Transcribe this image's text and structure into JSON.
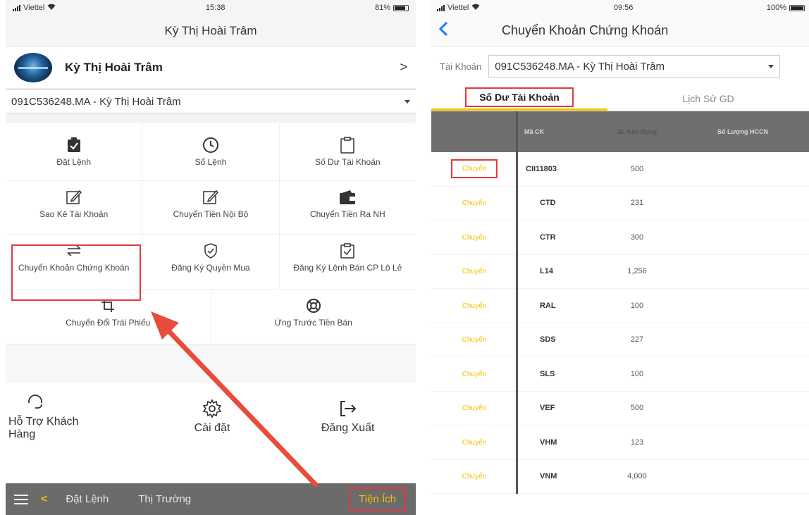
{
  "left": {
    "status": {
      "carrier": "Viettel",
      "time": "15:38",
      "battery": "81%",
      "battery_level": 0.81
    },
    "title": "Kỳ Thị Hoài Trâm",
    "profile_name": "Kỳ Thị Hoài Trâm",
    "account": "091C536248.MA - Kỳ Thị Hoài Trâm",
    "menu": {
      "row1": [
        "Đặt Lệnh",
        "Sổ Lệnh",
        "Số Dư Tài Khoản"
      ],
      "row2": [
        "Sao Kê Tài Khoản",
        "Chuyển Tiền Nội Bộ",
        "Chuyển Tiền Ra NH"
      ],
      "row3": [
        "Chuyển Khoản Chứng Khoán",
        "Đăng Ký Quyền Mua",
        "Đăng Ký Lệnh Bán CP Lô Lẻ"
      ],
      "row4": [
        "Chuyển Đổi Trái Phiếu",
        "Ứng Trước Tiền Bán"
      ]
    },
    "bottom_actions": [
      "Hỗ Trợ Khách Hàng",
      "Cài đặt",
      "Đăng Xuất"
    ],
    "tabbar": {
      "back": "<",
      "tabs": [
        "Đặt Lệnh",
        "Thị Trường",
        "Tiện Ích"
      ]
    },
    "accent_color": "#f2c200",
    "highlight_color": "#e0393e"
  },
  "right": {
    "status": {
      "carrier": "Viettel",
      "time": "09:56",
      "battery": "100%",
      "battery_level": 1.0
    },
    "title": "Chuyển Khoản Chứng Khoán",
    "account_label": "Tài Khoản",
    "account_value": "091C536248.MA - Kỳ Thị Hoài Trâm",
    "tabs": [
      "Số Dư Tài Khoản",
      "Lịch Sử GD"
    ],
    "table": {
      "headers": [
        "",
        "Mã CK",
        "SL Khả Dụng",
        "Số Lượng HCCN"
      ],
      "action_label": "Chuyển",
      "rows": [
        {
          "code": "CII11803",
          "qty": "500"
        },
        {
          "code": "CTD",
          "qty": "231"
        },
        {
          "code": "CTR",
          "qty": "300"
        },
        {
          "code": "L14",
          "qty": "1,256"
        },
        {
          "code": "RAL",
          "qty": "100"
        },
        {
          "code": "SDS",
          "qty": "227"
        },
        {
          "code": "SLS",
          "qty": "100"
        },
        {
          "code": "VEF",
          "qty": "500"
        },
        {
          "code": "VHM",
          "qty": "123"
        },
        {
          "code": "VNM",
          "qty": "4,000"
        }
      ]
    },
    "back_color": "#1b7cf2"
  }
}
